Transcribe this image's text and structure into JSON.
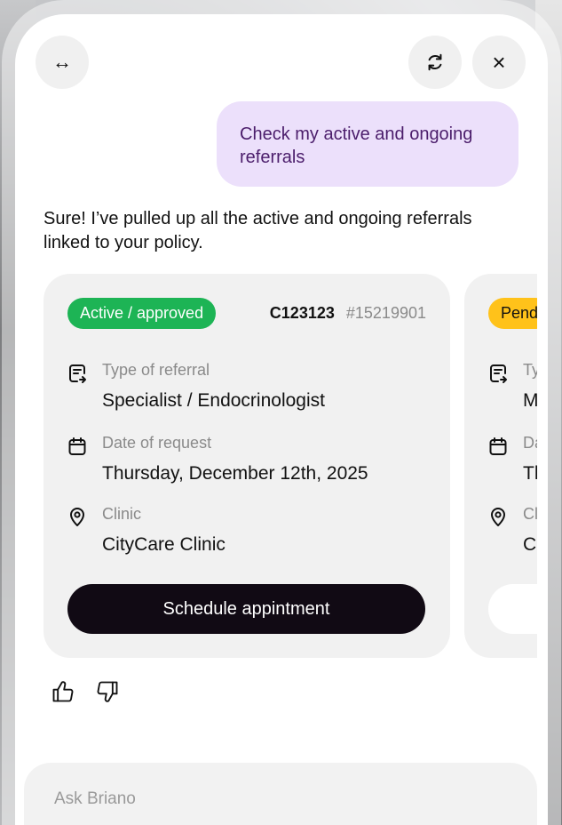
{
  "header": {
    "expand_icon": "↔",
    "refresh_icon": "refresh-icon",
    "close_icon": "×"
  },
  "user_message": "Check my active and ongoing referrals",
  "bot_message": "Sure! I’ve pulled up all the active and ongoing referrals linked to your policy.",
  "cards": [
    {
      "status": "Active / approved",
      "status_color": "#1db455",
      "code": "C123123",
      "number": "#15219901",
      "type_label": "Type of referral",
      "type_value": "Specialist / Endocrinologist",
      "date_label": "Date of request",
      "date_value": "Thursday, December 12th, 2025",
      "clinic_label": "Clinic",
      "clinic_value": "CityCare Clinic",
      "cta": "Schedule appintment"
    },
    {
      "status": "Pend",
      "status_color": "#ffc21a",
      "type_label": "Ty",
      "type_value": "M",
      "date_label": "Da",
      "date_value": "Th",
      "clinic_label": "Cl",
      "clinic_value": "C"
    }
  ],
  "input": {
    "placeholder": "Ask Briano"
  }
}
